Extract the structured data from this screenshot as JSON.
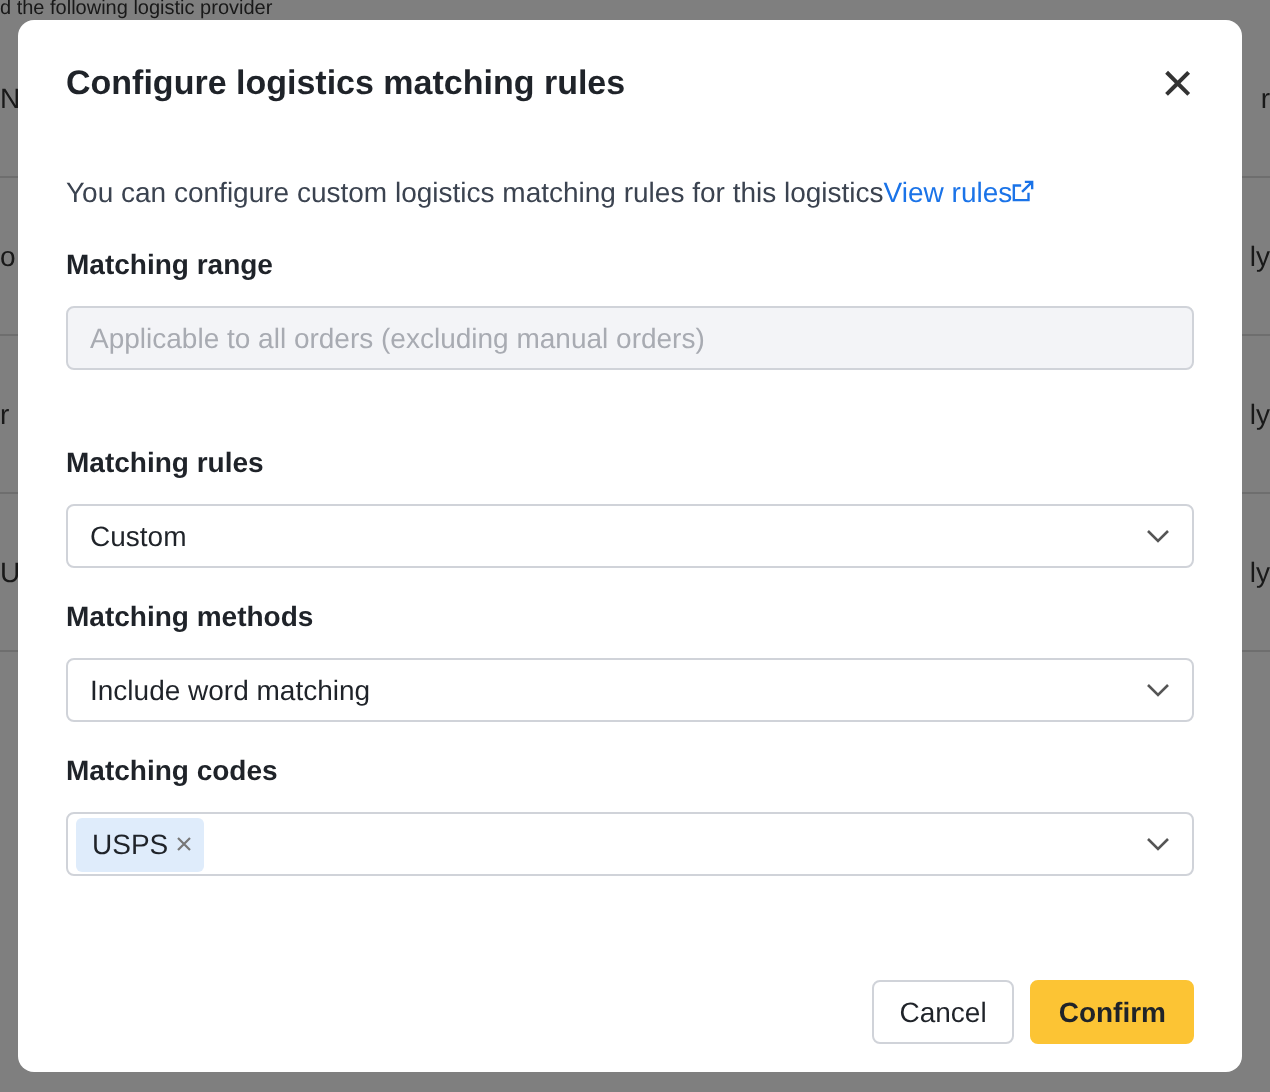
{
  "page_behind": {
    "heading": "d the following logistic provider",
    "rows": [
      {
        "left": "N",
        "right": "r"
      },
      {
        "left": "o",
        "right": "ly"
      },
      {
        "left": "r",
        "right": "ly"
      },
      {
        "left": "U",
        "right": "ly"
      }
    ]
  },
  "dialog": {
    "title": "Configure logistics matching rules",
    "close": "×",
    "intro": "You can configure custom logistics matching rules for this logistics",
    "link": "View rules",
    "fields": [
      {
        "kind": "input",
        "label": "Matching range",
        "placeholder": "Applicable to all orders (excluding manual orders)",
        "disabled": true
      },
      {
        "kind": "select",
        "label": "Matching rules",
        "value": "Custom"
      },
      {
        "kind": "select",
        "label": "Matching methods",
        "value": "Include word matching"
      },
      {
        "kind": "tags",
        "label": "Matching codes",
        "tags": [
          "USPS"
        ]
      }
    ],
    "buttons": [
      {
        "label": "Cancel",
        "primary": false
      },
      {
        "label": "Confirm",
        "primary": true
      }
    ]
  }
}
